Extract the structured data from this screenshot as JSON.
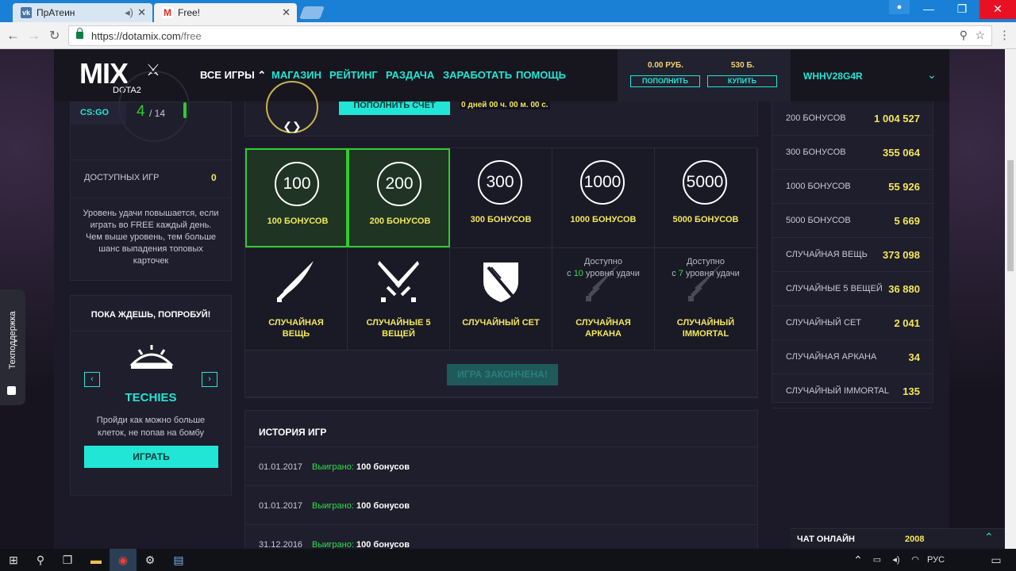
{
  "browser": {
    "tabs": [
      {
        "label": "ПрАтеин",
        "favicon": "vk-icon"
      },
      {
        "label": "Free!",
        "favicon": "gmail-icon"
      }
    ],
    "url_host": "https://dotamix.com",
    "url_path": "/free"
  },
  "header": {
    "logo_text": "MIX",
    "logo_sub": "DOTA2",
    "nav": [
      "ВСЕ ИГРЫ",
      "МАГАЗИН",
      "РЕЙТИНГ",
      "РАЗДАЧА",
      "ЗАРАБОТАТЬ",
      "ПОМОЩЬ"
    ],
    "balance_rub": "0.00 РУБ.",
    "balance_b": "530 Б.",
    "topup_label": "ПОПОЛНИТЬ",
    "buy_label": "КУПИТЬ",
    "username": "WHHV28G4R"
  },
  "left": {
    "game_tag": "CS:GO",
    "level_current": "4",
    "level_total": "/ 14",
    "available_label": "ДОСТУПНЫХ ИГР",
    "available_value": "0",
    "luck_text": "Уровень удачи повышается, если играть во FREE каждый день. Чем выше уровень, тем больше шанс выпадения топовых карточек",
    "try_title": "ПОКА ЖДЕШЬ, ПОПРОБУЙ!",
    "game_name": "TECHIES",
    "game_desc": "Пройди как можно больше клеток, не попав на бомбу",
    "play_label": "ИГРАТЬ"
  },
  "center": {
    "topup_button": "ПОПОЛНИТЬ СЧЕТ",
    "timer": "0 дней 00 ч. 00 м. 00 с.",
    "bonuses": [
      {
        "value": "100",
        "label": "100 БОНУСОВ",
        "selected": true
      },
      {
        "value": "200",
        "label": "200 БОНУСОВ",
        "selected": true
      },
      {
        "value": "300",
        "label": "300 БОНУСОВ",
        "selected": false
      },
      {
        "value": "1000",
        "label": "1000 БОНУСОВ",
        "selected": false
      },
      {
        "value": "5000",
        "label": "5000 БОНУСОВ",
        "selected": false
      }
    ],
    "items": [
      {
        "label": "СЛУЧАЙНАЯ ВЕЩЬ",
        "icon": "sword-icon"
      },
      {
        "label": "СЛУЧАЙНЫЕ 5 ВЕЩЕЙ",
        "icon": "crossed-swords-icon"
      },
      {
        "label": "СЛУЧАЙНЫЙ СЕТ",
        "icon": "shield-swords-icon"
      },
      {
        "label": "СЛУЧАЙНАЯ АРКАНА",
        "icon": "locked-sword-icon",
        "avail_prefix": "Доступно",
        "avail_c": "с",
        "avail_level": "10",
        "avail_suffix": "уровня удачи"
      },
      {
        "label": "СЛУЧАЙНЫЙ IMMORTAL",
        "icon": "locked-sword-icon",
        "avail_prefix": "Доступно",
        "avail_c": "с",
        "avail_level": "7",
        "avail_suffix": "уровня удачи"
      }
    ],
    "game_over": "ИГРА ЗАКОНЧЕНА!",
    "history_title": "ИСТОРИЯ ИГР",
    "history": [
      {
        "date": "01.01.2017",
        "won": "Выиграно:",
        "reward": "100 бонусов"
      },
      {
        "date": "01.01.2017",
        "won": "Выиграно:",
        "reward": "100 бонусов"
      },
      {
        "date": "31.12.2016",
        "won": "Выиграно:",
        "reward": "100 бонусов"
      }
    ]
  },
  "stats": [
    {
      "name": "200 БОНУСОВ",
      "value": "1 004 527"
    },
    {
      "name": "300 БОНУСОВ",
      "value": "355 064"
    },
    {
      "name": "1000 БОНУСОВ",
      "value": "55 926"
    },
    {
      "name": "5000 БОНУСОВ",
      "value": "5 669"
    },
    {
      "name": "СЛУЧАЙНАЯ ВЕЩЬ",
      "value": "373 098"
    },
    {
      "name": "СЛУЧАЙНЫЕ 5 ВЕЩЕЙ",
      "value": "36 880"
    },
    {
      "name": "СЛУЧАЙНЫЙ СЕТ",
      "value": "2 041"
    },
    {
      "name": "СЛУЧАЙНАЯ АРКАНА",
      "value": "34"
    },
    {
      "name": "СЛУЧАЙНЫЙ IMMORTAL",
      "value": "135"
    }
  ],
  "chat": {
    "label": "ЧАТ ОНЛАЙН",
    "count": "2008"
  },
  "support_label": "Техподдержка",
  "taskbar": {
    "lang": "РУС"
  },
  "colors": {
    "accent": "#21e6d6",
    "gold": "#f2e75a",
    "green": "#2ecc2e",
    "bg": "#1c1a28"
  }
}
